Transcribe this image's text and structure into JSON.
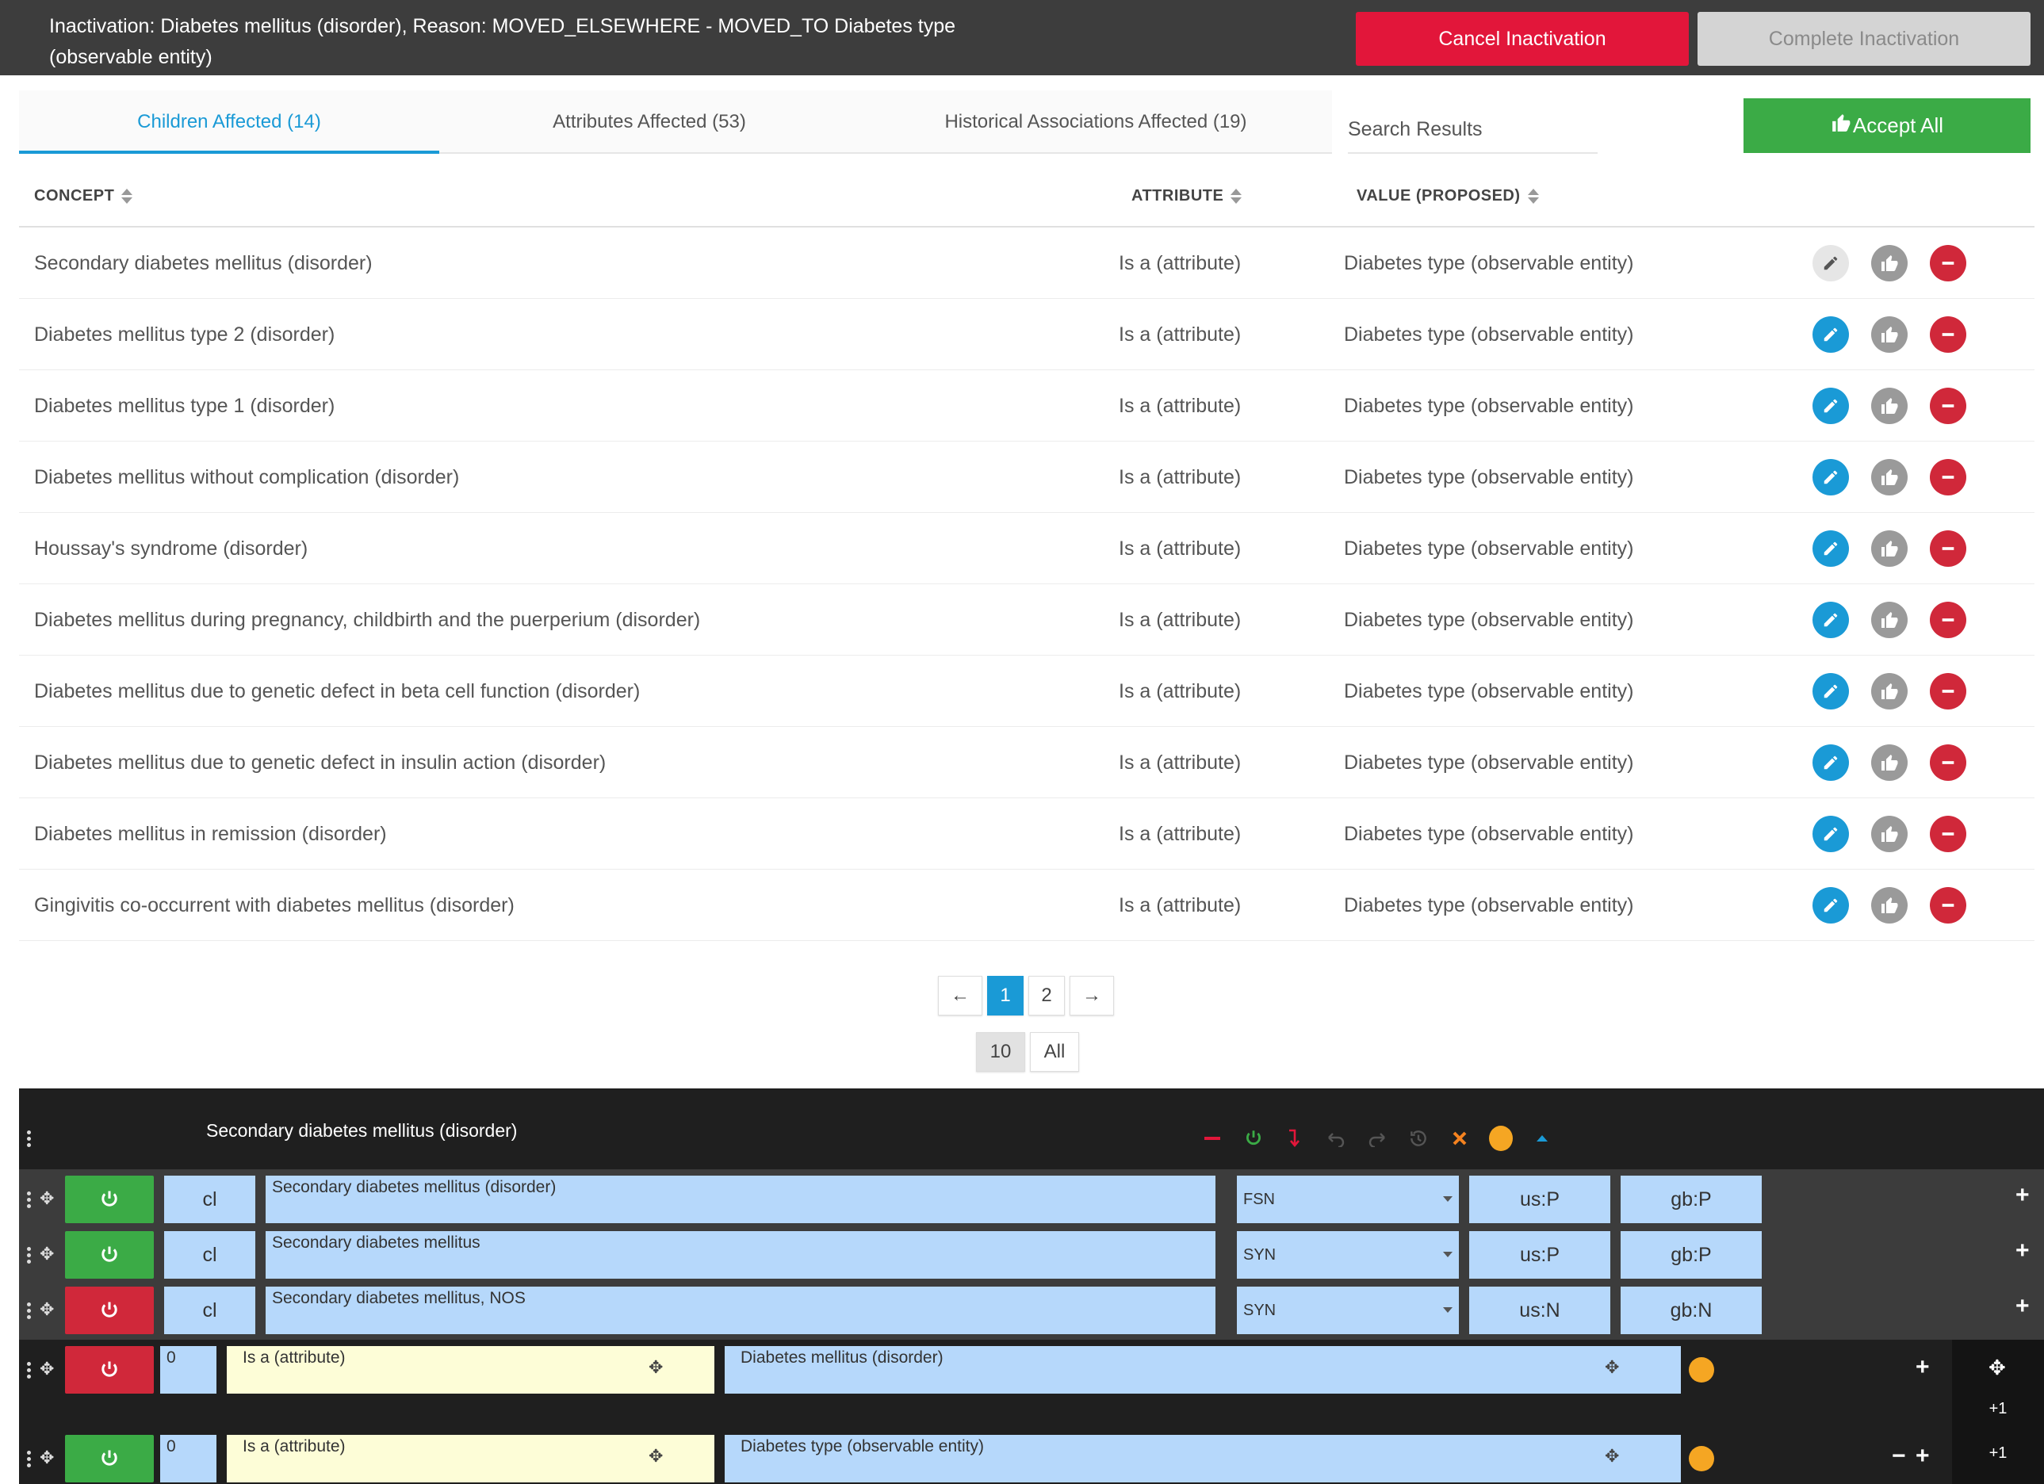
{
  "header": {
    "title": "Inactivation: Diabetes mellitus (disorder), Reason: MOVED_ELSEWHERE - MOVED_TO Diabetes type (observable entity)",
    "cancel_label": "Cancel Inactivation",
    "complete_label": "Complete Inactivation"
  },
  "tabs": [
    {
      "label": "Children Affected (14)",
      "active": true
    },
    {
      "label": "Attributes Affected (53)",
      "active": false
    },
    {
      "label": "Historical Associations Affected (19)",
      "active": false
    }
  ],
  "search": {
    "placeholder": "Search Results"
  },
  "accept_all_label": "Accept All",
  "table": {
    "columns": [
      "CONCEPT",
      "ATTRIBUTE",
      "VALUE (PROPOSED)"
    ],
    "rows": [
      {
        "concept": "Secondary diabetes mellitus (disorder)",
        "attribute": "Is a (attribute)",
        "value": "Diabetes type (observable entity)"
      },
      {
        "concept": "Diabetes mellitus type 2 (disorder)",
        "attribute": "Is a (attribute)",
        "value": "Diabetes type (observable entity)"
      },
      {
        "concept": "Diabetes mellitus type 1 (disorder)",
        "attribute": "Is a (attribute)",
        "value": "Diabetes type (observable entity)"
      },
      {
        "concept": "Diabetes mellitus without complication (disorder)",
        "attribute": "Is a (attribute)",
        "value": "Diabetes type (observable entity)"
      },
      {
        "concept": "Houssay's syndrome (disorder)",
        "attribute": "Is a (attribute)",
        "value": "Diabetes type (observable entity)"
      },
      {
        "concept": "Diabetes mellitus during pregnancy, childbirth and the puerperium (disorder)",
        "attribute": "Is a (attribute)",
        "value": "Diabetes type (observable entity)"
      },
      {
        "concept": "Diabetes mellitus due to genetic defect in beta cell function (disorder)",
        "attribute": "Is a (attribute)",
        "value": "Diabetes type (observable entity)"
      },
      {
        "concept": "Diabetes mellitus due to genetic defect in insulin action (disorder)",
        "attribute": "Is a (attribute)",
        "value": "Diabetes type (observable entity)"
      },
      {
        "concept": "Diabetes mellitus in remission (disorder)",
        "attribute": "Is a (attribute)",
        "value": "Diabetes type (observable entity)"
      },
      {
        "concept": "Gingivitis co-occurrent with diabetes mellitus (disorder)",
        "attribute": "Is a (attribute)",
        "value": "Diabetes type (observable entity)"
      }
    ]
  },
  "pagination": {
    "prev": "←",
    "pages": [
      "1",
      "2"
    ],
    "current": "1",
    "next": "→",
    "page_sizes": [
      "10",
      "All"
    ],
    "page_size_selected": "10"
  },
  "editor": {
    "title": "Secondary diabetes mellitus (disorder)",
    "descriptions": [
      {
        "active": true,
        "case": "cl",
        "term": "Secondary diabetes mellitus (disorder)",
        "type": "FSN",
        "us": "us:P",
        "gb": "gb:P"
      },
      {
        "active": true,
        "case": "cl",
        "term": "Secondary diabetes mellitus",
        "type": "SYN",
        "us": "us:P",
        "gb": "gb:P"
      },
      {
        "active": false,
        "case": "cl",
        "term": "Secondary diabetes mellitus, NOS",
        "type": "SYN",
        "us": "us:N",
        "gb": "gb:N"
      }
    ],
    "relationships": [
      {
        "active": false,
        "group": "0",
        "type": "Is a (attribute)",
        "target": "Diabetes mellitus (disorder)"
      },
      {
        "active": true,
        "group": "0",
        "type": "Is a (attribute)",
        "target": "Diabetes type (observable entity)"
      }
    ],
    "group_badges": [
      "+1",
      "+1"
    ]
  },
  "colors": {
    "accent": "#1a9ad6",
    "danger": "#e2163a",
    "success": "#3bab46",
    "field_blue": "#b6d8fb",
    "field_yellow": "#fdfdd7",
    "orange": "#f5a623"
  }
}
